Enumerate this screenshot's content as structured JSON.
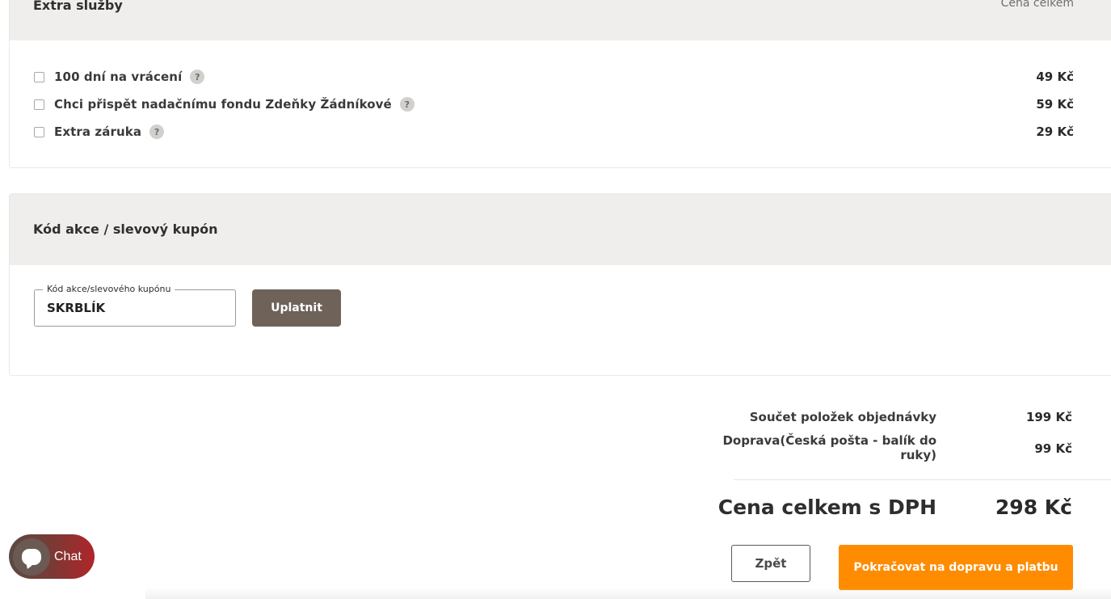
{
  "extra_services": {
    "title": "Extra služby",
    "price_column": "Cena celkem",
    "items": [
      {
        "label": "100 dní na vrácení",
        "help": "?",
        "price": "49 Kč",
        "checked": false
      },
      {
        "label": "Chci přispět nadačnímu fondu Zdeňky Žádníkové",
        "help": "?",
        "price": "59 Kč",
        "checked": false
      },
      {
        "label": "Extra záruka",
        "help": "?",
        "price": "29 Kč",
        "checked": false
      }
    ]
  },
  "coupon": {
    "title": "Kód akce / slevový kupón",
    "field_label": "Kód akce/slevového kupónu",
    "field_value": "SKRBLÍK",
    "apply_label": "Uplatnit"
  },
  "summary": {
    "items_label": "Součet položek objednávky",
    "items_value": "199 Kč",
    "shipping_label_line1": "Doprava(Česká pošta - balík do",
    "shipping_label_line2": "ruky)",
    "shipping_value": "99 Kč",
    "total_label": "Cena celkem s DPH",
    "total_value": "298 Kč"
  },
  "actions": {
    "back_label": "Zpět",
    "continue_label": "Pokračovat na dopravu a platbu"
  },
  "chat": {
    "label": "Chat"
  },
  "colors": {
    "accent_orange": "#ff8c00",
    "apply_brown": "#6f6259",
    "header_bg": "#efeeec"
  }
}
